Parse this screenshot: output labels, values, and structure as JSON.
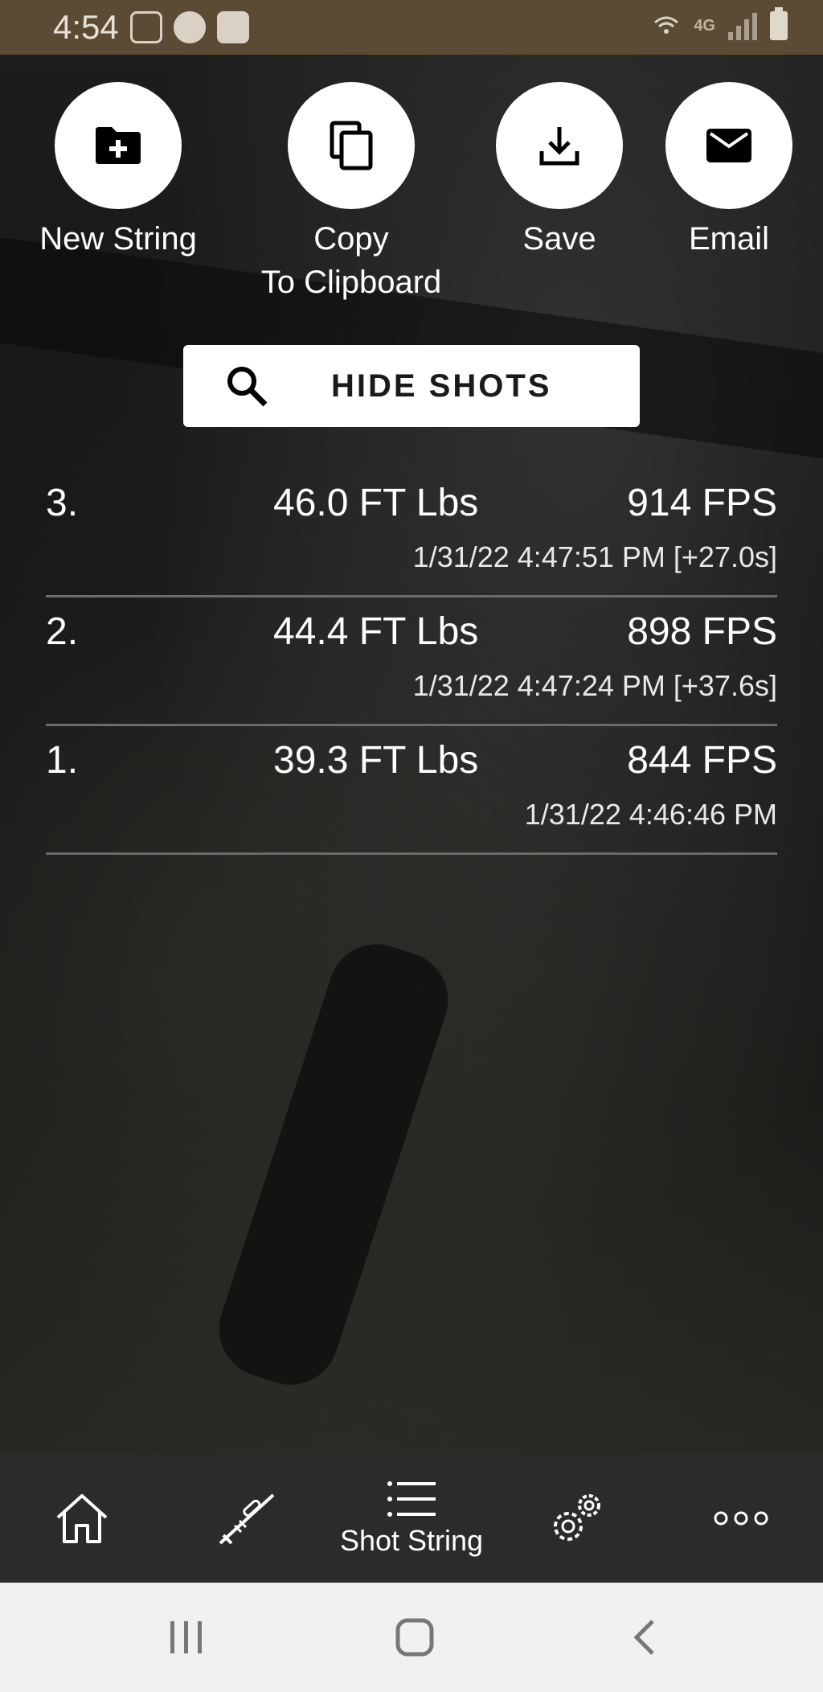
{
  "status_bar": {
    "time": "4:54",
    "network_label": "4G"
  },
  "actions": [
    {
      "label": "New String",
      "icon": "folder-plus-icon"
    },
    {
      "label": "Copy\nTo Clipboard",
      "icon": "copy-icon"
    },
    {
      "label": "Save",
      "icon": "download-icon"
    },
    {
      "label": "Email",
      "icon": "mail-icon"
    }
  ],
  "action_labels": {
    "new_string": "New String",
    "copy_line1": "Copy",
    "copy_line2": "To Clipboard",
    "save": "Save",
    "email": "Email"
  },
  "hide_shots": {
    "label": "HIDE SHOTS"
  },
  "shots": [
    {
      "number": "3.",
      "energy": "46.0 FT Lbs",
      "velocity": "914 FPS",
      "timestamp": "1/31/22 4:47:51 PM [+27.0s]"
    },
    {
      "number": "2.",
      "energy": "44.4 FT Lbs",
      "velocity": "898 FPS",
      "timestamp": "1/31/22 4:47:24 PM [+37.6s]"
    },
    {
      "number": "1.",
      "energy": "39.3 FT Lbs",
      "velocity": "844 FPS",
      "timestamp": "1/31/22 4:46:46 PM"
    }
  ],
  "bottom_nav": {
    "items": [
      {
        "icon": "home-icon"
      },
      {
        "icon": "rifle-icon"
      },
      {
        "icon": "list-icon",
        "label": "Shot String",
        "active": true
      },
      {
        "icon": "gears-icon"
      },
      {
        "icon": "more-icon"
      }
    ]
  },
  "colors": {
    "status_bar": "#5b4b34",
    "nav_bar": "#2b2b2b",
    "button_bg": "#ffffff",
    "divider": "#6b6b6b"
  }
}
